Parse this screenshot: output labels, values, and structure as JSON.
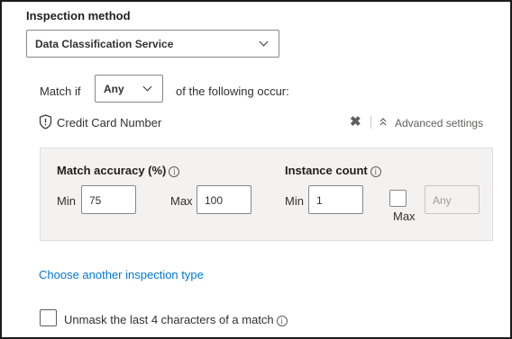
{
  "inspection_method": {
    "heading": "Inspection method",
    "selected": "Data Classification Service"
  },
  "match": {
    "prefix": "Match if",
    "selected": "Any",
    "suffix": "of the following occur:"
  },
  "sit": {
    "name": "Credit Card Number",
    "remove_icon": "close-icon",
    "advanced_label": "Advanced settings"
  },
  "accuracy": {
    "label": "Match accuracy (%)",
    "min_label": "Min",
    "min_value": "75",
    "max_label": "Max",
    "max_value": "100"
  },
  "instance": {
    "label": "Instance count",
    "min_label": "Min",
    "min_value": "1",
    "max_label": "Max",
    "max_checked": false,
    "max_placeholder": "Any"
  },
  "info_glyph": "i",
  "link": "Choose another inspection type",
  "unmask": {
    "label": "Unmask the last 4 characters of a match",
    "checked": false
  },
  "colors": {
    "link": "#0078d4",
    "panel": "#f3f2f1",
    "border": "#8a8886"
  }
}
